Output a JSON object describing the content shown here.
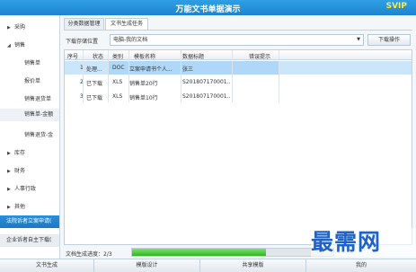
{
  "window": {
    "title": "万能文书单据演示",
    "badge": "SVIP"
  },
  "sidebar": {
    "categories": {
      "c0": "采购",
      "c1": "销售",
      "c2": "库存",
      "c3": "财务",
      "c4": "人事行政",
      "c5": "其他"
    },
    "sub": {
      "s0": "销售单",
      "s1": "报价单",
      "s2": "销售退货单",
      "s3": "销售单-金额",
      "s4": "销售退货-金"
    },
    "highlight": "法院诉者立案申请(",
    "business": "企业诉者自主下载("
  },
  "tabs": {
    "t0": "分类数据管理",
    "t1": "文书生成任务"
  },
  "toolbar": {
    "location_label": "下载存储位置",
    "location_value": "电脑-我的文档",
    "download_button": "下载操作"
  },
  "table": {
    "headers": {
      "h0": "序号",
      "h1": "状态",
      "h2": "类别",
      "h3": "模板名称",
      "h4": "数据标题",
      "h5": "错误提示"
    },
    "rows": [
      {
        "num": "1",
        "status": "处理...",
        "type": "DOC",
        "template": "立案申请书个人...",
        "title": "张三",
        "error": ""
      },
      {
        "num": "2",
        "status": "已下载",
        "type": "XLS",
        "template": "销售单20行",
        "title": "S201807170001...",
        "error": ""
      },
      {
        "num": "3",
        "status": "已下载",
        "type": "XLS",
        "template": "销售单10行",
        "title": "S201807170001...",
        "error": ""
      }
    ]
  },
  "progress": {
    "label": "文档生成进度：2/3",
    "fraction": 0.667
  },
  "watermark": "最需网",
  "bottom_nav": {
    "b0": "文书生成",
    "b1": "模版设计",
    "b2": "共享模版",
    "b3": "我的"
  },
  "colors": {
    "titlebar": "#1e84cf",
    "highlight": "#1c78c2",
    "progress": "#2fb522",
    "watermark": "#1f63c7",
    "badge": "#ffe94a"
  },
  "icons": {
    "collapsed": "triangle-right-icon",
    "expanded": "triangle-down-icon",
    "dropdown": "chevron-down-icon"
  }
}
